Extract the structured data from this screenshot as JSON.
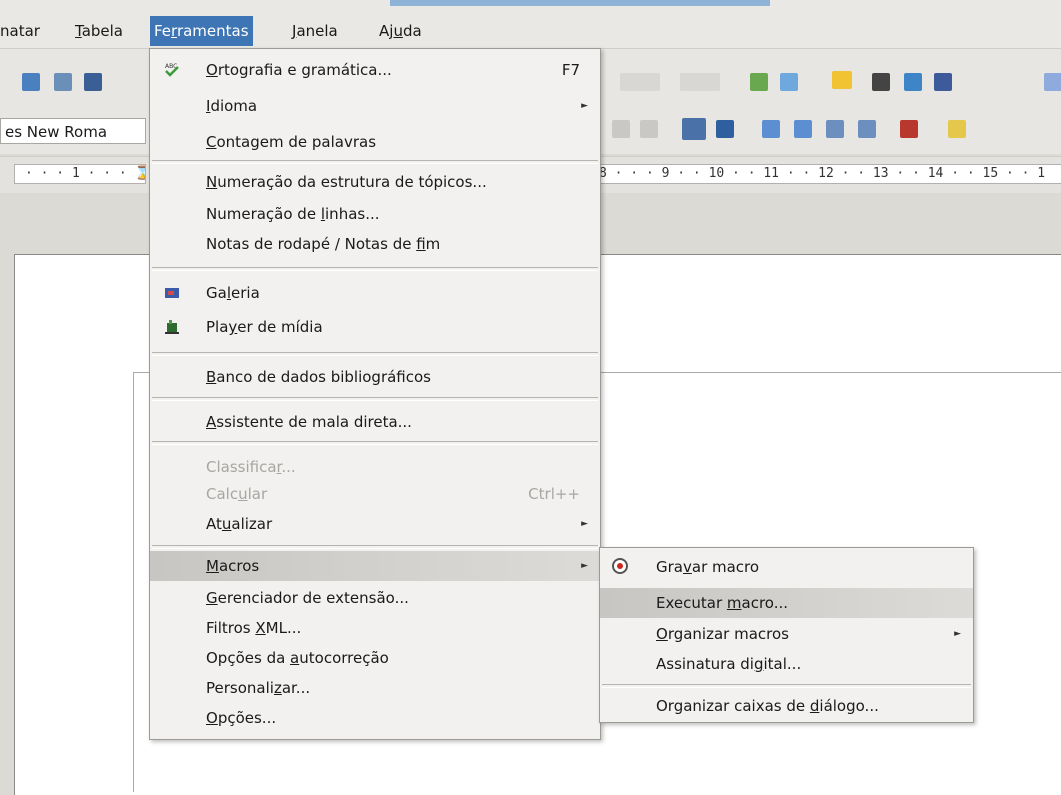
{
  "menubar": {
    "items": [
      {
        "label": "natar",
        "pre": "",
        "ul": "",
        "post": "natar"
      },
      {
        "label": "Tabela",
        "pre": "",
        "ul": "T",
        "post": "abela"
      },
      {
        "label": "Ferramentas",
        "pre": "Fe",
        "ul": "r",
        "post": "ramentas"
      },
      {
        "label": "Janela",
        "pre": "",
        "ul": "J",
        "post": "anela"
      },
      {
        "label": "Ajuda",
        "pre": "Aj",
        "ul": "u",
        "post": "da"
      }
    ]
  },
  "toolbar": {
    "font_name": "es New Roma",
    "ruler_left": "· · · 1 · · · ⌛",
    "ruler_right": "8 · · · 9 · · 10 · · 11 · · 12 · · 13 · · 14 · · 15 · · 1"
  },
  "menu": {
    "items": [
      {
        "pre": "",
        "ul": "O",
        "post": "rtografia e gramática...",
        "shortcut": "F7"
      },
      {
        "pre": "",
        "ul": "I",
        "post": "dioma"
      },
      {
        "pre": "",
        "ul": "C",
        "post": "ontagem de palavras"
      },
      {
        "pre": "",
        "ul": "N",
        "post": "umeração da estrutura de tópicos..."
      },
      {
        "pre": "Numeração de ",
        "ul": "l",
        "post": "inhas..."
      },
      {
        "pre": "Notas de rodapé / Notas de ",
        "ul": "f",
        "post": "im"
      },
      {
        "pre": "Ga",
        "ul": "l",
        "post": "eria"
      },
      {
        "pre": "Pla",
        "ul": "y",
        "post": "er de mídia"
      },
      {
        "pre": "",
        "ul": "B",
        "post": "anco de dados bibliográficos"
      },
      {
        "pre": "",
        "ul": "A",
        "post": "ssistente de mala direta..."
      },
      {
        "pre": "Classifica",
        "ul": "r",
        "post": "..."
      },
      {
        "pre": "Calc",
        "ul": "u",
        "post": "lar",
        "shortcut": "Ctrl++"
      },
      {
        "pre": "At",
        "ul": "u",
        "post": "alizar"
      },
      {
        "pre": "",
        "ul": "M",
        "post": "acros"
      },
      {
        "pre": "",
        "ul": "G",
        "post": "erenciador de extensão..."
      },
      {
        "pre": "Filtros ",
        "ul": "X",
        "post": "ML..."
      },
      {
        "pre": "Opções da ",
        "ul": "a",
        "post": "utocorreção"
      },
      {
        "pre": "Personali",
        "ul": "z",
        "post": "ar..."
      },
      {
        "pre": "",
        "ul": "O",
        "post": "pções..."
      }
    ]
  },
  "submenu": {
    "items": [
      {
        "pre": "Gra",
        "ul": "v",
        "post": "ar macro"
      },
      {
        "pre": "Executar ",
        "ul": "m",
        "post": "acro..."
      },
      {
        "pre": "",
        "ul": "O",
        "post": "rganizar macros"
      },
      {
        "pre": "Assinatura di",
        "ul": "g",
        "post": "ital..."
      },
      {
        "pre": "Organizar caixas de ",
        "ul": "d",
        "post": "iálogo..."
      }
    ]
  }
}
